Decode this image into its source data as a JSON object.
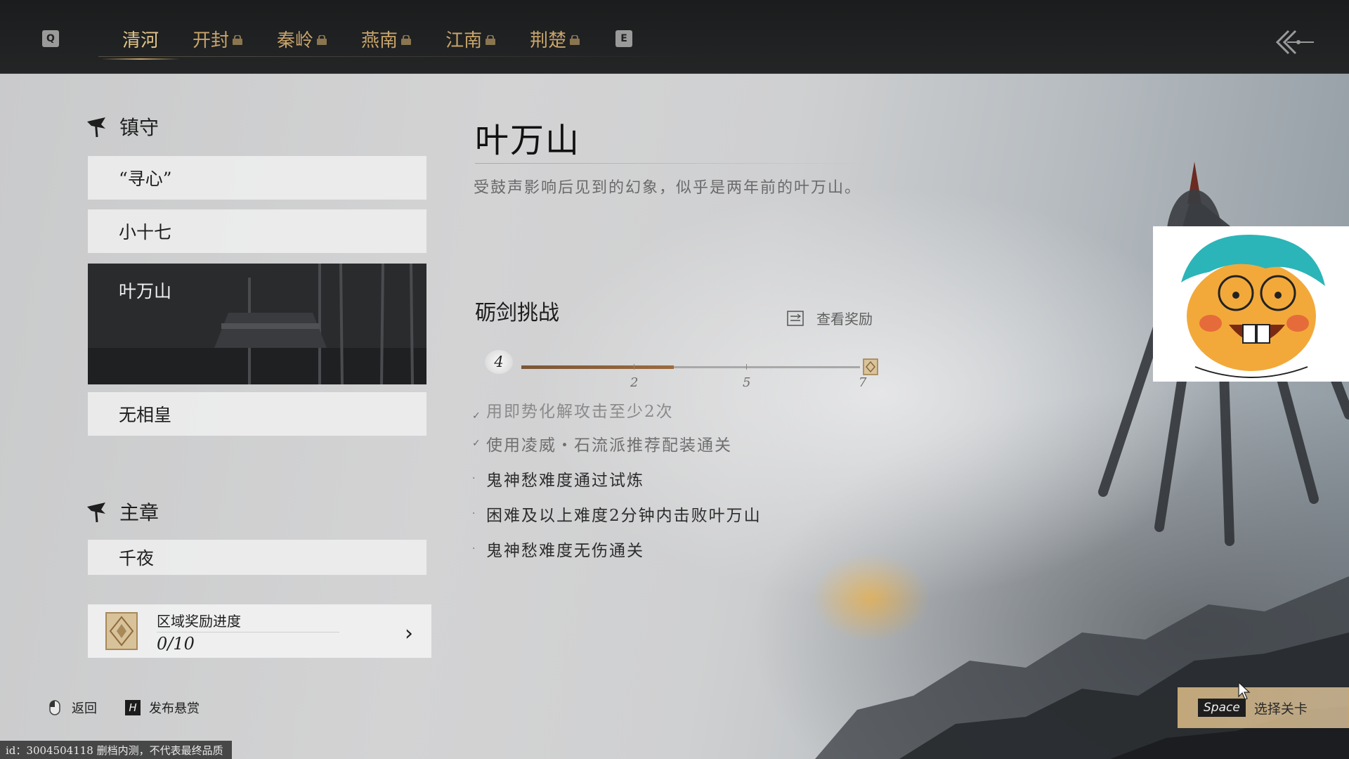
{
  "top_nav": {
    "left_key": "Q",
    "right_key": "E",
    "tabs": [
      {
        "label": "清河",
        "active": true,
        "locked": false
      },
      {
        "label": "开封",
        "active": false,
        "locked": true
      },
      {
        "label": "秦岭",
        "active": false,
        "locked": true
      },
      {
        "label": "燕南",
        "active": false,
        "locked": true
      },
      {
        "label": "江南",
        "active": false,
        "locked": true
      },
      {
        "label": "荆楚",
        "active": false,
        "locked": true
      }
    ]
  },
  "sidebar": {
    "section_guard": {
      "title": "镇守",
      "items": [
        "“寻心”",
        "小十七",
        "叶万山",
        "无相皇"
      ],
      "selected": "叶万山"
    },
    "section_main": {
      "title": "主章",
      "items": [
        "千夜"
      ]
    },
    "region_reward": {
      "label": "区域奖励进度",
      "progress": "0/10"
    }
  },
  "detail": {
    "boss_name": "叶万山",
    "description": "受鼓声影响后见到的幻象，似乎是两年前的叶万山。",
    "challenge": {
      "title": "砺剑挑战",
      "view_rewards": "查看奖励",
      "current": "4",
      "progress_fraction": 0.45,
      "milestones": [
        "2",
        "5",
        "7"
      ],
      "tasks": [
        {
          "text": "用即势化解攻击至少2次",
          "done": true,
          "partially_hidden": true
        },
        {
          "text": "使用凌威・石流派推荐配装通关",
          "done": true
        },
        {
          "text": "鬼神愁难度通过试炼",
          "done": false
        },
        {
          "text": "困难及以上难度2分钟内击败叶万山",
          "done": false
        },
        {
          "text": "鬼神愁难度无伤通关",
          "done": false
        }
      ]
    }
  },
  "hints": {
    "back_label": "返回",
    "bounty_key": "H",
    "bounty_label": "发布悬赏"
  },
  "prompt": {
    "key": "Space",
    "label": "选择关卡"
  },
  "footnote": "id：3004504118  删档内测，不代表最终品质",
  "colors": {
    "accent_gold": "#c9a46a",
    "progress_fill": "#8a5f3a",
    "topbar_bg": "#1a1c1d"
  }
}
